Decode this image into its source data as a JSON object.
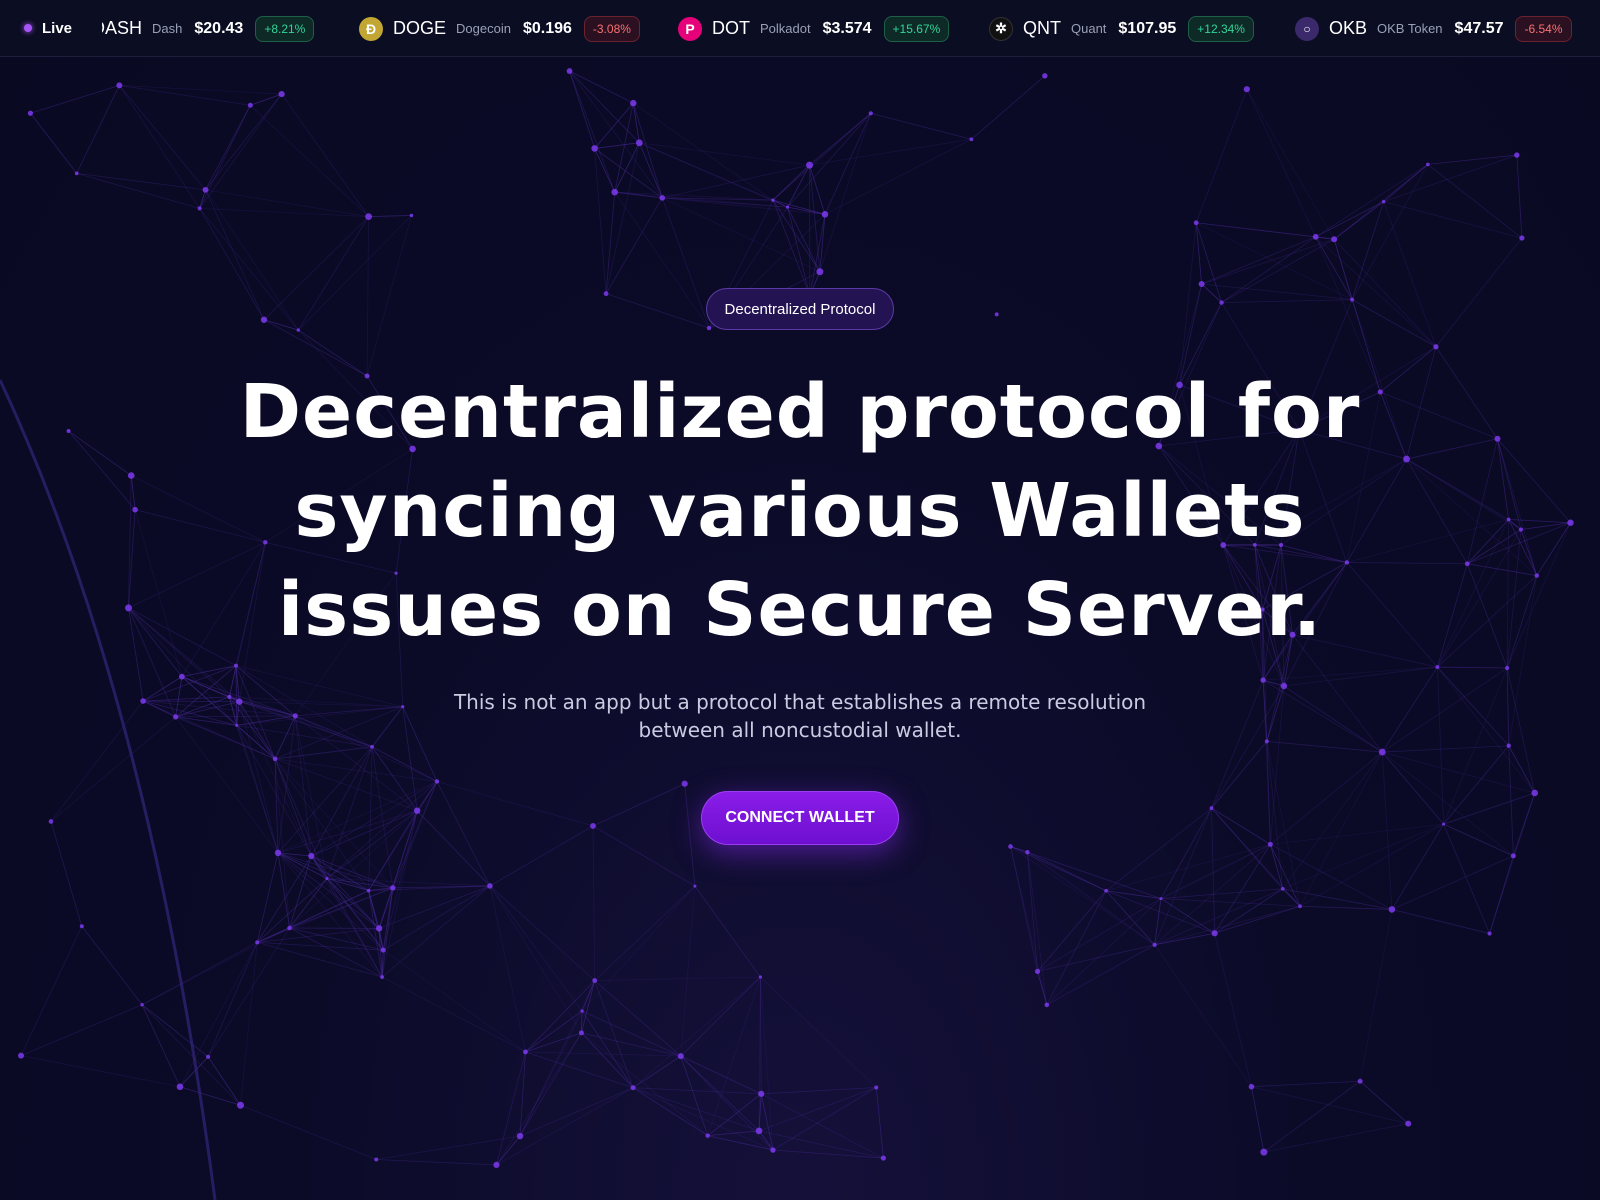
{
  "ticker": {
    "live_label": "Live",
    "coins": [
      {
        "symbol": "DASH",
        "name": "Dash",
        "price": "$20.43",
        "change": "+8.21%",
        "direction": "up",
        "icon": "dash-icon",
        "icon_glyph": "",
        "icon_color": "#0b0d22"
      },
      {
        "symbol": "DOGE",
        "name": "Dogecoin",
        "price": "$0.196",
        "change": "-3.08%",
        "direction": "down",
        "icon": "dogecoin-icon",
        "icon_glyph": "Ð",
        "icon_color": "#c2a633"
      },
      {
        "symbol": "DOT",
        "name": "Polkadot",
        "price": "$3.574",
        "change": "+15.67%",
        "direction": "up",
        "icon": "polkadot-icon",
        "icon_glyph": "P",
        "icon_color": "#e6007a"
      },
      {
        "symbol": "QNT",
        "name": "Quant",
        "price": "$107.95",
        "change": "+12.34%",
        "direction": "up",
        "icon": "quant-icon",
        "icon_glyph": "✲",
        "icon_color": "#111111"
      },
      {
        "symbol": "OKB",
        "name": "OKB Token",
        "price": "$47.57",
        "change": "-6.54%",
        "direction": "down",
        "icon": "okb-icon",
        "icon_glyph": "○",
        "icon_color": "#3b2a6b"
      }
    ]
  },
  "hero": {
    "badge": "Decentralized Protocol",
    "headline_line1": "Decentralized protocol for",
    "headline_line2": "syncing various Wallets",
    "headline_line3": "issues on Secure Server.",
    "subtitle_line1": "This is not an app but a protocol that establishes a remote resolution",
    "subtitle_line2": "between all noncustodial wallet.",
    "cta_label": "CONNECT WALLET"
  },
  "colors": {
    "background": "#0a0a24",
    "accent": "#8b1de8",
    "network_line": "#4b2a9a",
    "network_node": "#7c3aed",
    "positive": "#34d399",
    "negative": "#f87171"
  }
}
